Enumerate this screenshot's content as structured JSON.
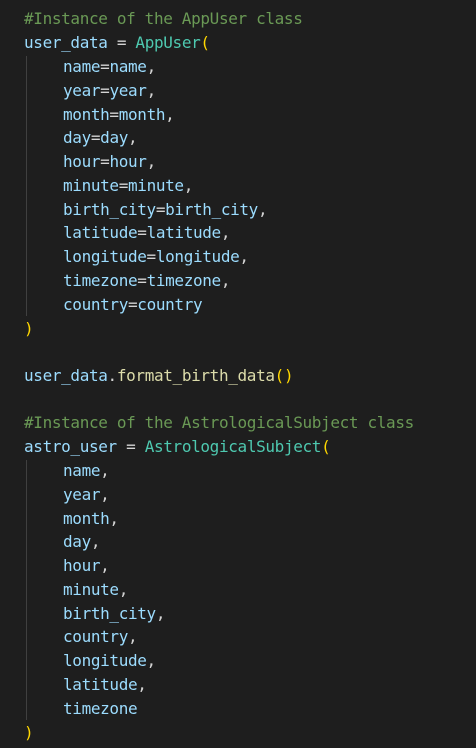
{
  "block1": {
    "comment": "#Instance of the AppUser class",
    "var": "user_data",
    "assign": " = ",
    "cls": "AppUser",
    "open": "(",
    "args": [
      {
        "k": "name",
        "v": "name",
        "sep": ","
      },
      {
        "k": "year",
        "v": "year",
        "sep": ","
      },
      {
        "k": "month",
        "v": "month",
        "sep": ","
      },
      {
        "k": "day",
        "v": "day",
        "sep": ","
      },
      {
        "k": "hour",
        "v": "hour",
        "sep": ","
      },
      {
        "k": "minute",
        "v": "minute",
        "sep": ","
      },
      {
        "k": "birth_city",
        "v": "birth_city",
        "sep": ","
      },
      {
        "k": "latitude",
        "v": "latitude",
        "sep": ","
      },
      {
        "k": "longitude",
        "v": "longitude",
        "sep": ","
      },
      {
        "k": "timezone",
        "v": "timezone",
        "sep": ","
      },
      {
        "k": "country",
        "v": "country",
        "sep": ""
      }
    ],
    "eq": "=",
    "close": ")"
  },
  "call": {
    "obj": "user_data",
    "dot": ".",
    "method": "format_birth_data",
    "parens": "()"
  },
  "block2": {
    "comment": "#Instance of the AstrologicalSubject class",
    "var": "astro_user",
    "assign": " = ",
    "cls": "AstrologicalSubject",
    "open": "(",
    "args": [
      {
        "v": "name",
        "sep": ","
      },
      {
        "v": "year",
        "sep": ","
      },
      {
        "v": "month",
        "sep": ","
      },
      {
        "v": "day",
        "sep": ","
      },
      {
        "v": "hour",
        "sep": ","
      },
      {
        "v": "minute",
        "sep": ","
      },
      {
        "v": "birth_city",
        "sep": ","
      },
      {
        "v": "country",
        "sep": ","
      },
      {
        "v": "longitude",
        "sep": ","
      },
      {
        "v": "latitude",
        "sep": ","
      },
      {
        "v": "timezone",
        "sep": ""
      }
    ],
    "close": ")"
  },
  "colors": {
    "background": "#1e1e1e",
    "comment": "#6a9955",
    "variable": "#9cdcfe",
    "class": "#4ec9b0",
    "function": "#dcdcaa",
    "bracket": "#ffd700",
    "text": "#d4d4d4"
  }
}
